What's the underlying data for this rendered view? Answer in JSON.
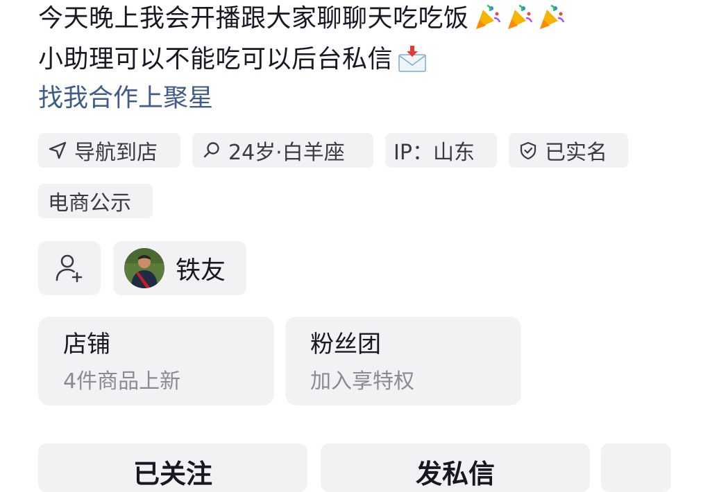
{
  "bio": {
    "line1": "今天晚上我会开播跟大家聊聊天吃吃饭",
    "line2": "小助理可以不能吃可以后台私信",
    "link": "找我合作上聚星"
  },
  "tags": {
    "navigate": "导航到店",
    "profile": "24岁·白羊座",
    "ip": "IP：山东",
    "verified": "已实名",
    "ecommerce": "电商公示"
  },
  "social": {
    "friend_label": "铁友"
  },
  "cards": {
    "shop": {
      "title": "店铺",
      "subtitle": "4件商品上新"
    },
    "fanclub": {
      "title": "粉丝团",
      "subtitle": "加入享特权"
    }
  },
  "actions": {
    "followed": "已关注",
    "message": "发私信"
  },
  "colors": {
    "link": "#3f5b8a",
    "tag_bg": "#f2f2f4",
    "text": "#161823",
    "muted": "#8a8b91"
  }
}
